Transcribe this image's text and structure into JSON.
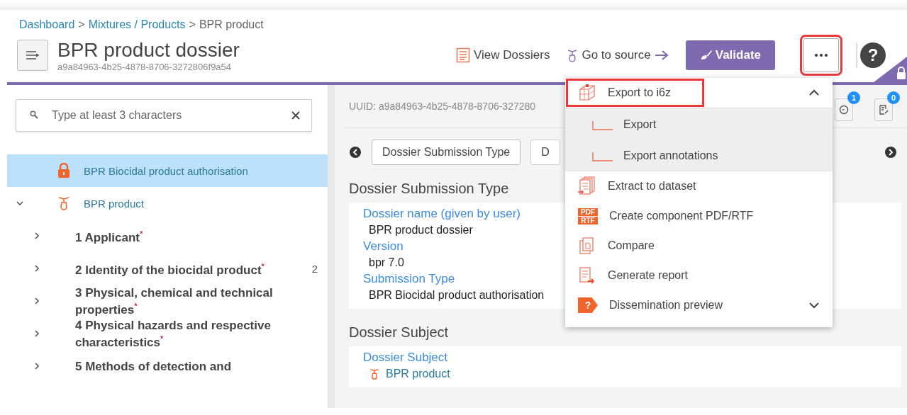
{
  "breadcrumb": [
    {
      "label": "Dashboard",
      "link": true
    },
    {
      "label": "Mixtures / Products",
      "link": true
    },
    {
      "label": "BPR product",
      "link": false
    }
  ],
  "breadcrumb_separator": ">",
  "header": {
    "title": "BPR product dossier",
    "subtitle": "a9a84963-4b25-4878-8706-3272806f9a54",
    "actions": [
      {
        "kind": "link",
        "label": "View Dossiers"
      },
      {
        "kind": "source",
        "label": "Go to source"
      },
      {
        "kind": "primary",
        "label": "Validate"
      }
    ],
    "more": {
      "highlighted": true
    },
    "help": {
      "glyph": "?"
    }
  },
  "search": {
    "placeholder": "Type at least 3 characters"
  },
  "tree": [
    {
      "label": "BPR Biocidal product authorisation",
      "selected": true
    },
    {
      "label": "BPR product",
      "selected": false,
      "expanded": true,
      "children": [
        {
          "label": "1 Applicant$^{*}$",
          "expanded": false,
          "selected": false
        },
        {
          "label": "2 Identity of the biocidal product$^{*}$",
          "count": "2",
          "expanded": false,
          "selected": false
        },
        {
          "label": "3 Physical, chemical and technical properties$^{*}$",
          "expanded": false,
          "selected": false
        },
        {
          "label": "4 Physical hazards and respective characteristics$^{*}$",
          "expanded": false,
          "selected": false
        },
        {
          "label": "5 Methods of detection and",
          "expanded": false,
          "selected": false
        }
      ]
    }
  ],
  "content": {
    "uuid": "UUID: a9a84963-4b25-4878-8706-327280",
    "toolbar_icons": [
      {
        "badge": "1"
      },
      {
        "badge": "0"
      }
    ],
    "tabs": [
      {
        "label": "Dossier Submission Type",
        "selected": true
      },
      {
        "label": "D",
        "selected": false
      }
    ],
    "sections": [
      {
        "title": "Dossier Submission Type",
        "fields": [
          {
            "label": "Dossier name (given by user)",
            "value": "BPR product dossier",
            "link": false
          },
          {
            "label": "Version",
            "value": "bpr 7.0",
            "link": false
          },
          {
            "label": "Submission Type",
            "value": "BPR Biocidal product authorisation",
            "link": false
          }
        ]
      },
      {
        "title": "Dossier Subject",
        "fields": [
          {
            "label": "Dossier Subject",
            "value": "BPR product",
            "link": true
          }
        ]
      }
    ]
  },
  "menu": {
    "items": [
      {
        "kind": "group",
        "label": "Export to i6z",
        "expanded": true,
        "highlighted": true,
        "children": [
          {
            "label": "Export"
          },
          {
            "label": "Export annotations"
          }
        ]
      },
      {
        "kind": "item",
        "label": "Extract to dataset"
      },
      {
        "kind": "item",
        "label": "Create component PDF/RTF",
        "icon_text": [
          "PDF",
          "RTF"
        ]
      },
      {
        "kind": "item",
        "label": "Compare"
      },
      {
        "kind": "item",
        "label": "Generate report"
      },
      {
        "kind": "group",
        "label": "Dissemination preview",
        "icon_text": [
          "?"
        ],
        "expanded": false,
        "highlighted": false
      }
    ]
  }
}
